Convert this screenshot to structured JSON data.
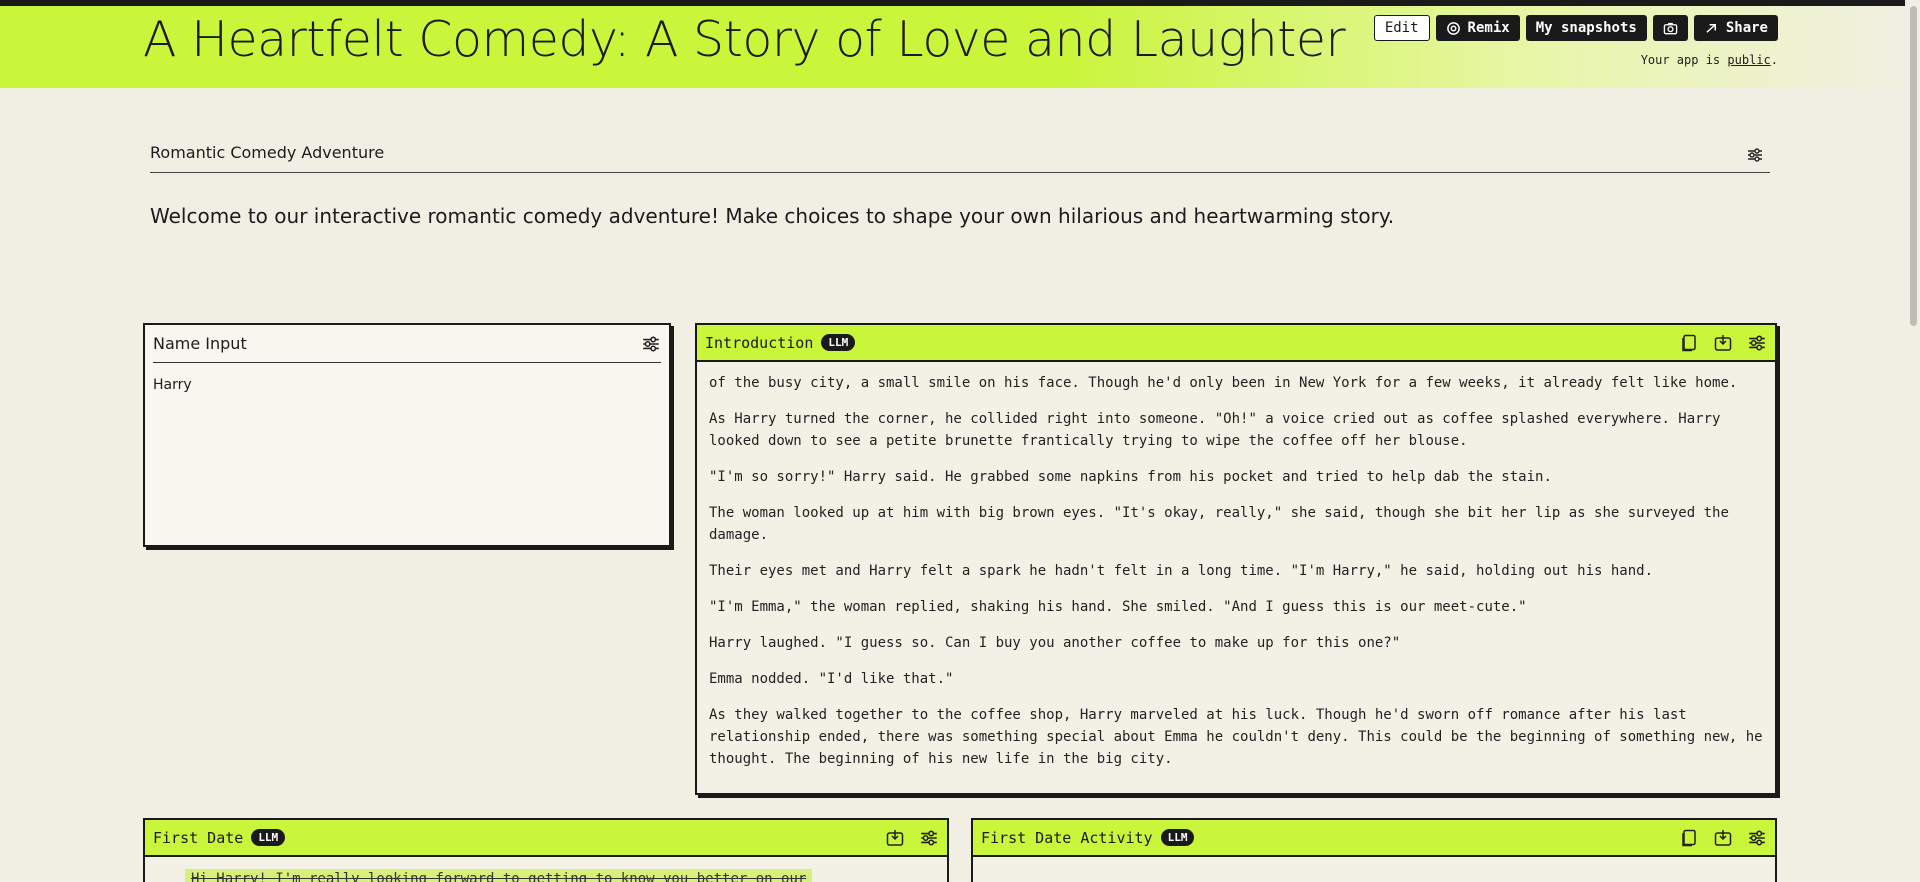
{
  "header": {
    "title": "A Heartfelt Comedy: A Story of Love and Laughter",
    "edit_label": "Edit",
    "remix_label": "Remix",
    "snapshots_label": "My snapshots",
    "share_label": "Share",
    "public_prefix": "Your app is",
    "public_link": "public",
    "public_suffix": "."
  },
  "section": {
    "title": "Romantic Comedy Adventure",
    "welcome": "Welcome to our interactive romantic comedy adventure! Make choices to shape your own hilarious and heartwarming story."
  },
  "name_card": {
    "title": "Name Input",
    "value": "Harry"
  },
  "intro_card": {
    "title": "Introduction",
    "badge": "LLM",
    "paragraphs": [
      "of the busy city, a small smile on his face. Though he'd only been in New York for a few weeks, it already felt like home.",
      "As Harry turned the corner, he collided right into someone. \"Oh!\" a voice cried out as coffee splashed everywhere. Harry looked down to see a petite brunette frantically trying to wipe the coffee off her blouse.",
      "\"I'm so sorry!\" Harry said. He grabbed some napkins from his pocket and tried to help dab the stain.",
      "The woman looked up at him with big brown eyes. \"It's okay, really,\" she said, though she bit her lip as she surveyed the damage.",
      "Their eyes met and Harry felt a spark he hadn't felt in a long time. \"I'm Harry,\" he said, holding out his hand.",
      "\"I'm Emma,\" the woman replied, shaking his hand. She smiled. \"And I guess this is our meet-cute.\"",
      "Harry laughed. \"I guess so. Can I buy you another coffee to make up for this one?\"",
      "Emma nodded. \"I'd like that.\"",
      "As they walked together to the coffee shop, Harry marveled at his luck. Though he'd sworn off romance after his last relationship ended, there was something special about Emma he couldn't deny. This could be the beginning of something new, he thought. The beginning of his new life in the big city."
    ]
  },
  "first_date_card": {
    "title": "First Date",
    "badge": "LLM",
    "peek": "Hi Harry! I'm really looking forward to getting to know you better on our"
  },
  "activity_card": {
    "title": "First Date Activity",
    "badge": "LLM"
  }
}
